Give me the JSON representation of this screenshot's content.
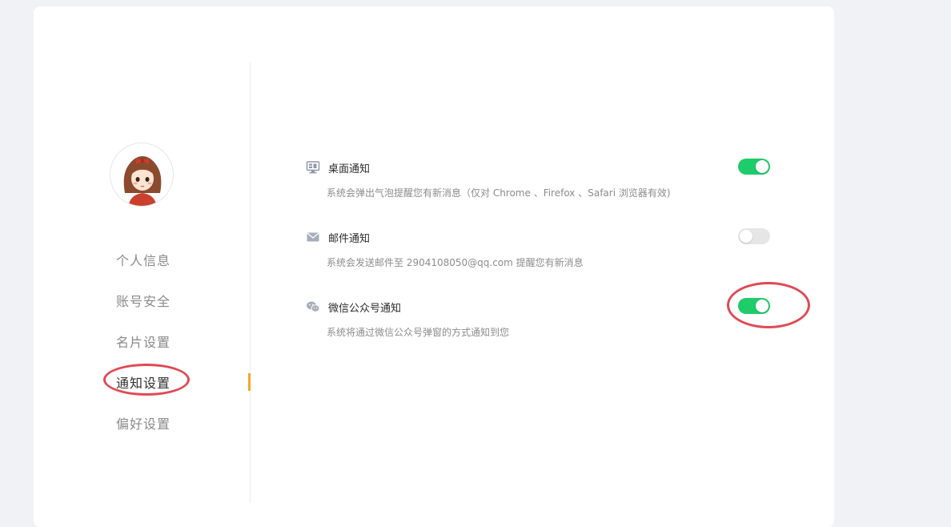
{
  "sidebar": {
    "items": [
      {
        "label": "个人信息"
      },
      {
        "label": "账号安全"
      },
      {
        "label": "名片设置"
      },
      {
        "label": "通知设置"
      },
      {
        "label": "偏好设置"
      }
    ],
    "active_item": "通知设置"
  },
  "settings": [
    {
      "title": "桌面通知",
      "description": "系统会弹出气泡提醒您有新消息（仅对 Chrome 、Firefox 、Safari 浏览器有效)",
      "icon": "desktop-icon",
      "enabled": true
    },
    {
      "title": "邮件通知",
      "description": "系统会发送邮件至 2904108050@qq.com 提醒您有新消息",
      "icon": "mail-icon",
      "enabled": false
    },
    {
      "title": "微信公众号通知",
      "description": "系统将通过微信公众号弹窗的方式通知到您",
      "icon": "wechat-icon",
      "enabled": true
    }
  ],
  "colors": {
    "toggle_on": "#1fcc6a",
    "toggle_off": "#e6e6e6",
    "active_marker": "#f5a623",
    "annotation": "#e04a54"
  }
}
